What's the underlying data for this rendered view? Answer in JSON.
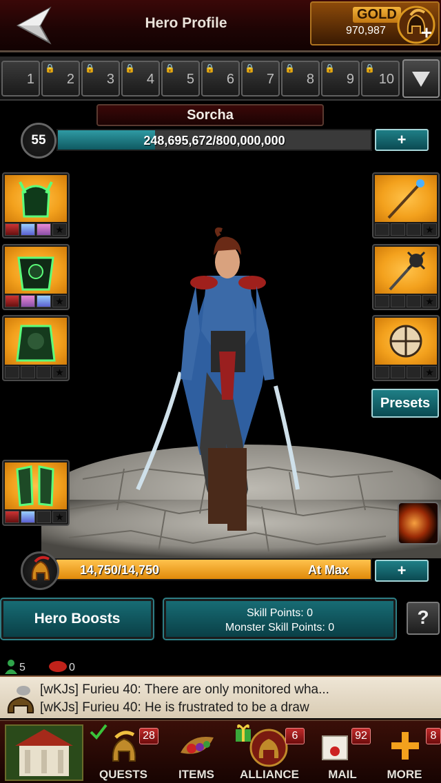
{
  "header": {
    "title": "Hero Profile",
    "gold_label": "GOLD",
    "gold_value": "970,987"
  },
  "slot_tabs": [
    "1",
    "2",
    "3",
    "4",
    "5",
    "6",
    "7",
    "8",
    "9",
    "10"
  ],
  "hero": {
    "name": "Sorcha",
    "level": "55",
    "xp_text": "248,695,672/800,000,000",
    "xp_fraction": 0.31,
    "xp_plus": "+"
  },
  "presets_label": "Presets",
  "power": {
    "value": "14,750/14,750",
    "status": "At Max",
    "fraction": 1.0,
    "plus": "+"
  },
  "boosts_label": "Hero Boosts",
  "skill_points": {
    "line1": "Skill Points: 0",
    "line2": "Monster Skill Points: 0"
  },
  "help_label": "?",
  "online": {
    "members": "5",
    "other": "0"
  },
  "chat": [
    "[wKJs] Furieu 40: There are only monitored wha...",
    "[wKJs] Furieu 40: He is frustrated to be a draw"
  ],
  "nav": [
    {
      "label": "",
      "badge": ""
    },
    {
      "label": "QUESTS",
      "badge": "28"
    },
    {
      "label": "ITEMS",
      "badge": ""
    },
    {
      "label": "ALLIANCE",
      "badge": "6"
    },
    {
      "label": "MAIL",
      "badge": "92"
    },
    {
      "label": "MORE",
      "badge": "8"
    }
  ],
  "colors": {
    "accent_teal": "#176c74",
    "gold": "#f3a11d",
    "header_red": "#3a0808"
  }
}
